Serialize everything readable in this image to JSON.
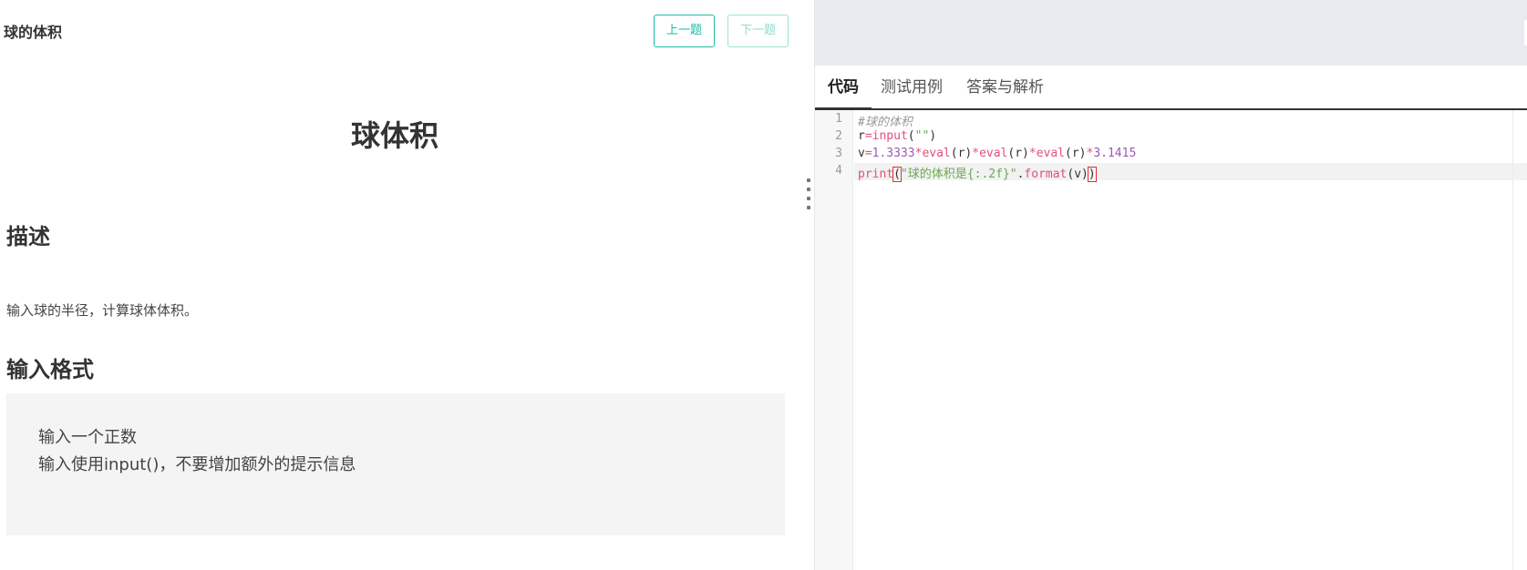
{
  "problem": {
    "title": "球的体积",
    "prev_label": "上一题",
    "next_label": "下一题",
    "heading": "球体积",
    "description_heading": "描述",
    "description_text": "输入球的半径，计算球体体积。",
    "input_format_heading": "输入格式",
    "input_format_lines": [
      "输入一个正数",
      "输入使用input()，不要增加额外的提示信息"
    ]
  },
  "editor": {
    "tabs": [
      {
        "label": "代码",
        "active": true
      },
      {
        "label": "测试用例",
        "active": false
      },
      {
        "label": "答案与解析",
        "active": false
      }
    ],
    "line_numbers": [
      "1",
      "2",
      "3",
      "4"
    ],
    "code": {
      "l1": "#球的体积",
      "l2": {
        "a": "r",
        "b": "=",
        "c": "input",
        "d": "(",
        "e": "\"\"",
        "f": ")"
      },
      "l3": {
        "a": "v",
        "b": "=",
        "c": "1.3333",
        "d": "*",
        "e": "eval",
        "f": "(r)",
        "g": "*",
        "h": "eval",
        "i": "(r)",
        "j": "*",
        "k": "eval",
        "l": "(r)",
        "m": "*",
        "n": "3.1415"
      },
      "l4": {
        "a": "print",
        "b": "(",
        "c": "\"球的体积是{:.2f}\"",
        "d": ".",
        "e": "format",
        "f": "(v)",
        "g": ")"
      }
    }
  },
  "colors": {
    "accent": "#1fb9a3",
    "keyword": "#e2507a",
    "string": "#6aa84f",
    "number": "#9b59b6"
  }
}
